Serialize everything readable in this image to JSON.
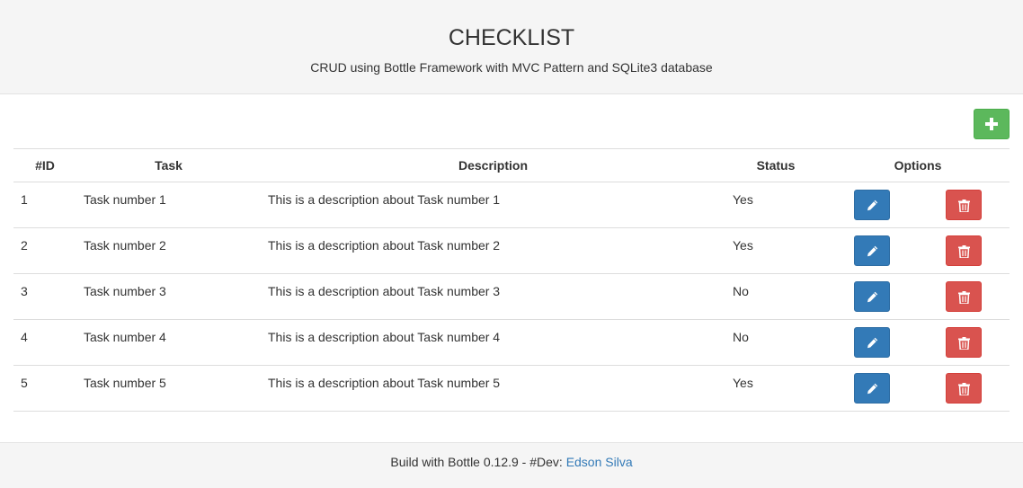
{
  "header": {
    "title": "CHECKLIST",
    "subtitle": "CRUD using Bottle Framework with MVC Pattern and SQLite3 database"
  },
  "toolbar": {
    "add_icon": "plus-icon",
    "add_color": "#5cb85c"
  },
  "table": {
    "columns": [
      "#ID",
      "Task",
      "Description",
      "Status",
      "Options"
    ],
    "rows": [
      {
        "id": "1",
        "task": "Task number 1",
        "description": "This is a description about Task number 1",
        "status": "Yes"
      },
      {
        "id": "2",
        "task": "Task number 2",
        "description": "This is a description about Task number 2",
        "status": "Yes"
      },
      {
        "id": "3",
        "task": "Task number 3",
        "description": "This is a description about Task number 3",
        "status": "No"
      },
      {
        "id": "4",
        "task": "Task number 4",
        "description": "This is a description about Task number 4",
        "status": "No"
      },
      {
        "id": "5",
        "task": "Task number 5",
        "description": "This is a description about Task number 5",
        "status": "Yes"
      }
    ],
    "edit_icon": "pencil-icon",
    "delete_icon": "trash-icon",
    "edit_color": "#337ab7",
    "delete_color": "#d9534f"
  },
  "footer": {
    "text": "Build with Bottle 0.12.9 - #Dev: ",
    "author_link": "Edson Silva"
  }
}
